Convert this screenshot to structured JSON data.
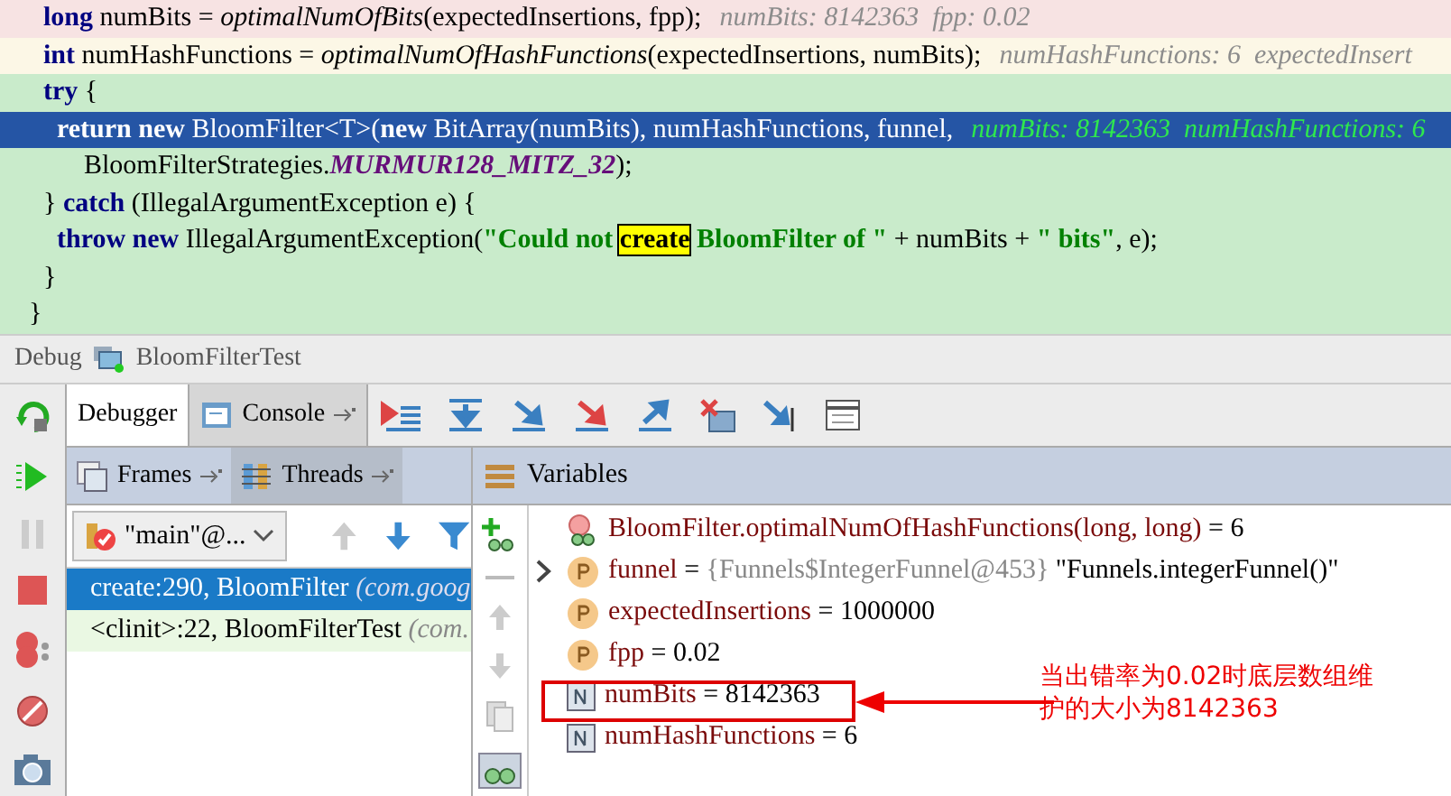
{
  "editor": {
    "lines": [
      {
        "kind": "error",
        "segments": [
          {
            "kind": "keyword",
            "text": "long"
          },
          {
            "kind": "plain",
            "text": " numBits = "
          },
          {
            "kind": "method",
            "text": "optimalNumOfBits"
          },
          {
            "kind": "plain",
            "text": "(expectedInsertions, fpp);"
          },
          {
            "kind": "hint",
            "text": "numBits: 8142363  fpp: 0.02"
          }
        ]
      },
      {
        "kind": "warning",
        "segments": [
          {
            "kind": "keyword",
            "text": "int"
          },
          {
            "kind": "plain",
            "text": " numHashFunctions = "
          },
          {
            "kind": "method",
            "text": "optimalNumOfHashFunctions"
          },
          {
            "kind": "plain",
            "text": "(expectedInsertions, numBits);"
          },
          {
            "kind": "hint",
            "text": "numHashFunctions: 6  expectedInsert"
          }
        ]
      },
      {
        "kind": "normal",
        "segments": [
          {
            "kind": "keyword",
            "text": "try"
          },
          {
            "kind": "plain",
            "text": " {"
          }
        ]
      },
      {
        "kind": "current",
        "segments": [
          {
            "kind": "keyword",
            "text": "  return new"
          },
          {
            "kind": "plain",
            "text": " BloomFilter<T>("
          },
          {
            "kind": "keyword",
            "text": "new"
          },
          {
            "kind": "plain",
            "text": " BitArray(numBits), numHashFunctions, funnel,"
          },
          {
            "kind": "hint",
            "text": "numBits: 8142363  numHashFunctions: 6"
          }
        ]
      },
      {
        "kind": "normal",
        "segments": [
          {
            "kind": "plain",
            "text": "      BloomFilterStrategies."
          },
          {
            "kind": "constant",
            "text": "MURMUR128_MITZ_32"
          },
          {
            "kind": "plain",
            "text": ");"
          }
        ]
      },
      {
        "kind": "normal",
        "segments": [
          {
            "kind": "plain",
            "text": "}"
          },
          {
            "kind": "keyword",
            "text": " catch"
          },
          {
            "kind": "plain",
            "text": " (IllegalArgumentException e) {"
          }
        ]
      },
      {
        "kind": "normal",
        "segments": [
          {
            "kind": "keyword",
            "text": "  throw new"
          },
          {
            "kind": "plain",
            "text": " IllegalArgumentException("
          },
          {
            "kind": "string",
            "text": "\"Could not "
          },
          {
            "kind": "match",
            "text": "create"
          },
          {
            "kind": "string",
            "text": " BloomFilter of \""
          },
          {
            "kind": "plain",
            "text": " + numBits + "
          },
          {
            "kind": "string",
            "text": "\" bits\""
          },
          {
            "kind": "plain",
            "text": ", e);"
          }
        ]
      },
      {
        "kind": "normal",
        "segments": [
          {
            "kind": "plain",
            "text": "}"
          }
        ]
      },
      {
        "kind": "outer",
        "segments": [
          {
            "kind": "plain",
            "text": "}"
          }
        ]
      }
    ]
  },
  "debug": {
    "title": "Debug",
    "config": "BloomFilterTest"
  },
  "tabs": [
    {
      "label": "Debugger",
      "selected": true
    },
    {
      "label": "Console",
      "selected": false
    }
  ],
  "frames_panel": {
    "tabs": [
      {
        "label": "Frames",
        "selected": true
      },
      {
        "label": "Threads",
        "selected": false
      }
    ],
    "thread": "\"main\"@...",
    "frames": [
      {
        "method": "create:290, BloomFilter",
        "package": "(com.goog",
        "selected": true
      },
      {
        "method": "<clinit>:22, BloomFilterTest",
        "package": "(com.",
        "selected": false
      }
    ]
  },
  "variables": {
    "title": "Variables",
    "items": [
      {
        "kind": "method",
        "expandable": false,
        "name": "BloomFilter.optimalNumOfHashFunctions(long, long)",
        "eq": "=",
        "value": "6"
      },
      {
        "kind": "param",
        "expandable": true,
        "name": "funnel",
        "eq": "=",
        "ref": "{Funnels$IntegerFunnel@453}",
        "value": "\"Funnels.integerFunnel()\""
      },
      {
        "kind": "param",
        "expandable": false,
        "name": "expectedInsertions",
        "eq": "=",
        "value": "1000000"
      },
      {
        "kind": "param",
        "expandable": false,
        "name": "fpp",
        "eq": "=",
        "value": "0.02"
      },
      {
        "kind": "field",
        "expandable": false,
        "name": "numBits",
        "eq": "=",
        "value": "8142363"
      },
      {
        "kind": "field",
        "expandable": false,
        "name": "numHashFunctions",
        "eq": "=",
        "value": "6"
      }
    ]
  },
  "annotation": {
    "text": "当出错率为0.02时底层数组维护的大小为8142363"
  }
}
